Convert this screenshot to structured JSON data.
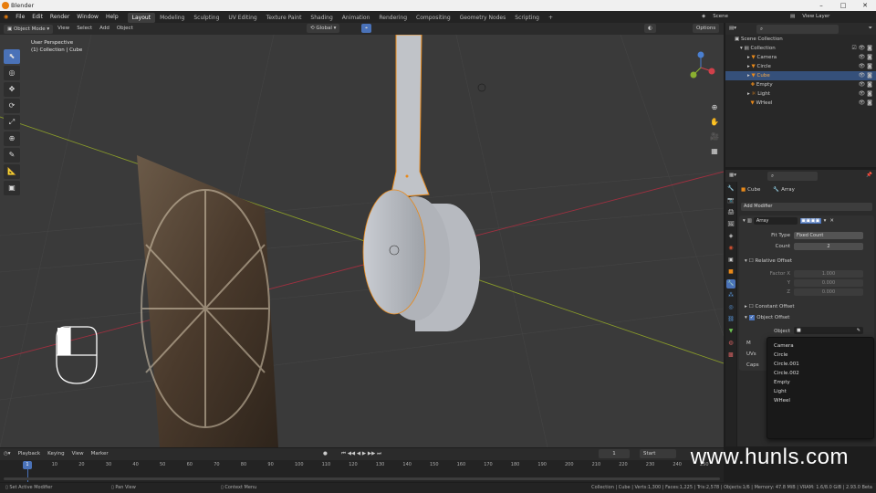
{
  "window": {
    "title": "Blender",
    "minimize": "–",
    "maximize": "□",
    "close": "✕"
  },
  "menu": [
    "File",
    "Edit",
    "Render",
    "Window",
    "Help"
  ],
  "workspaces": [
    "Layout",
    "Modeling",
    "Sculpting",
    "UV Editing",
    "Texture Paint",
    "Shading",
    "Animation",
    "Rendering",
    "Compositing",
    "Geometry Nodes",
    "Scripting"
  ],
  "active_workspace": "Layout",
  "scene": {
    "label": "Scene",
    "view_layer": "View Layer"
  },
  "viewport_header": {
    "mode": "Object Mode",
    "menus": [
      "View",
      "Select",
      "Add",
      "Object"
    ],
    "transform": "Global",
    "options": "Options"
  },
  "viewport": {
    "perspective": "User Perspective",
    "collection": "(1) Collection | Cube"
  },
  "outliner": {
    "root": "Scene Collection",
    "collection": "Collection",
    "items": [
      {
        "name": "Camera",
        "selected": false
      },
      {
        "name": "Circle",
        "selected": false
      },
      {
        "name": "Cube",
        "selected": true
      },
      {
        "name": "Empty",
        "selected": false
      },
      {
        "name": "Light",
        "selected": false
      },
      {
        "name": "WHeel",
        "selected": false
      }
    ]
  },
  "properties": {
    "object": "Cube",
    "modifier_type": "Array",
    "add_modifier": "Add Modifier",
    "modifier_name": "Array",
    "fit_type_label": "Fit Type",
    "fit_type": "Fixed Count",
    "count_label": "Count",
    "count": "2",
    "relative_offset": "Relative Offset",
    "factor_x_label": "Factor X",
    "factor_y_label": "Y",
    "factor_z_label": "Z",
    "factor_x": "1.000",
    "factor_y": "0.000",
    "factor_z": "0.000",
    "constant_offset": "Constant Offset",
    "object_offset": "Object Offset",
    "object_label": "Object",
    "collapsed": [
      "M",
      "UVs",
      "Caps"
    ]
  },
  "dropdown": [
    "Camera",
    "Circle",
    "Circle.001",
    "Circle.002",
    "Empty",
    "Light",
    "WHeel"
  ],
  "timeline": {
    "menus": [
      "Playback",
      "Keying",
      "View",
      "Marker"
    ],
    "current_frame": "1",
    "start_label": "Start",
    "ticks": [
      "1",
      "10",
      "20",
      "30",
      "40",
      "50",
      "60",
      "70",
      "80",
      "90",
      "100",
      "110",
      "120",
      "130",
      "140",
      "150",
      "160",
      "170",
      "180",
      "190",
      "200",
      "210",
      "220",
      "230",
      "240",
      "250"
    ]
  },
  "statusbar": {
    "left1": "Set Active Modifier",
    "left2": "Pan View",
    "left3": "Context Menu",
    "right": "Collection | Cube | Verts:1,300 | Faces:1,225 | Tris:2,578 | Objects:1/6 | Memory: 47.8 MiB | VRAM: 1.6/8.0 GiB | 2.93.0 Beta"
  },
  "watermark": "www.hunls.com",
  "colors": {
    "accent": "#4a72b8",
    "selection": "#35507a",
    "orange": "#e8891a",
    "viewport_bg": "#3a3a3a"
  }
}
